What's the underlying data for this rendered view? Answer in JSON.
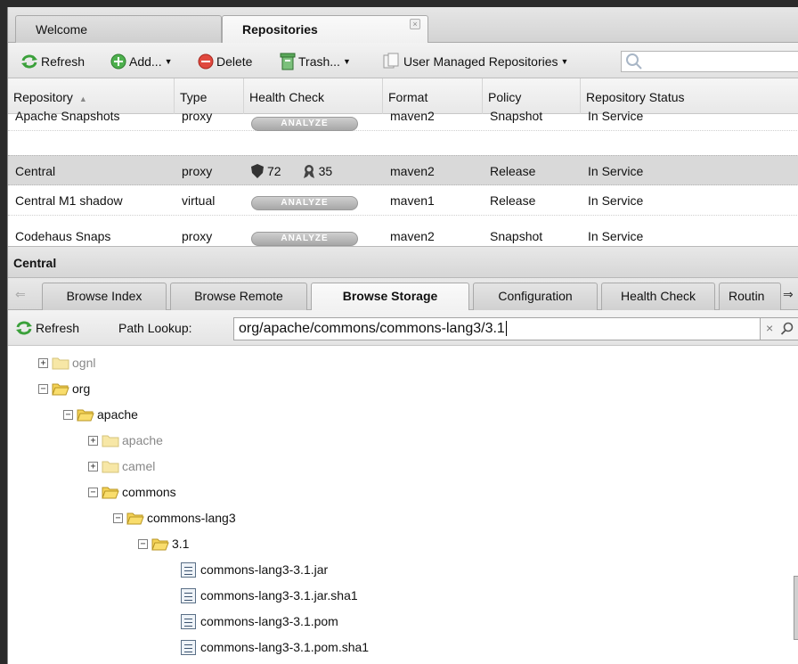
{
  "tabs": [
    {
      "label": "Welcome",
      "active": false
    },
    {
      "label": "Repositories",
      "active": true,
      "close": "×"
    }
  ],
  "toolbar": {
    "refresh": "Refresh",
    "add": "Add...",
    "delete": "Delete",
    "trash": "Trash...",
    "user_managed": "User Managed Repositories",
    "search_placeholder": ""
  },
  "grid": {
    "columns": [
      "Repository",
      "Type",
      "Health Check",
      "Format",
      "Policy",
      "Repository Status"
    ],
    "rows": [
      {
        "repository": "Apache Snapshots",
        "type": "proxy",
        "health": "ANALYZE",
        "format": "maven2",
        "policy": "Snapshot",
        "status": "In Service"
      },
      {
        "repository": "Central",
        "type": "proxy",
        "health_security": "72",
        "health_license": "35",
        "format": "maven2",
        "policy": "Release",
        "status": "In Service",
        "selected": true
      },
      {
        "repository": "Central M1 shadow",
        "type": "virtual",
        "health": "ANALYZE",
        "format": "maven1",
        "policy": "Release",
        "status": "In Service"
      },
      {
        "repository": "Codehaus Snaps",
        "type": "proxy",
        "health": "ANALYZE",
        "format": "maven2",
        "policy": "Snapshot",
        "status": "In Service"
      }
    ]
  },
  "detail": {
    "title": "Central",
    "tabs": [
      "Browse Index",
      "Browse Remote",
      "Browse Storage",
      "Configuration",
      "Health Check",
      "Routin"
    ],
    "active_tab": "Browse Storage",
    "refresh": "Refresh",
    "path_label": "Path Lookup:",
    "path_value": "org/apache/commons/commons-lang3/3.1"
  },
  "tree": [
    {
      "label": "ognl",
      "kind": "folder",
      "expanded": false,
      "dim": true
    },
    {
      "label": "org",
      "kind": "folder",
      "expanded": true
    },
    {
      "label": "apache",
      "kind": "folder",
      "expanded": true
    },
    {
      "label": "apache",
      "kind": "folder",
      "expanded": false,
      "dim": true
    },
    {
      "label": "camel",
      "kind": "folder",
      "expanded": false,
      "dim": true
    },
    {
      "label": "commons",
      "kind": "folder",
      "expanded": true
    },
    {
      "label": "commons-lang3",
      "kind": "folder",
      "expanded": true
    },
    {
      "label": "3.1",
      "kind": "folder",
      "expanded": true
    },
    {
      "label": "commons-lang3-3.1.jar",
      "kind": "file"
    },
    {
      "label": "commons-lang3-3.1.jar.sha1",
      "kind": "file"
    },
    {
      "label": "commons-lang3-3.1.pom",
      "kind": "file"
    },
    {
      "label": "commons-lang3-3.1.pom.sha1",
      "kind": "file"
    }
  ],
  "colors": {
    "selected_row": "#d9d9d9",
    "folder": "#f4d256",
    "refresh_green": "#3aa03a",
    "delete_red": "#e0483e"
  }
}
